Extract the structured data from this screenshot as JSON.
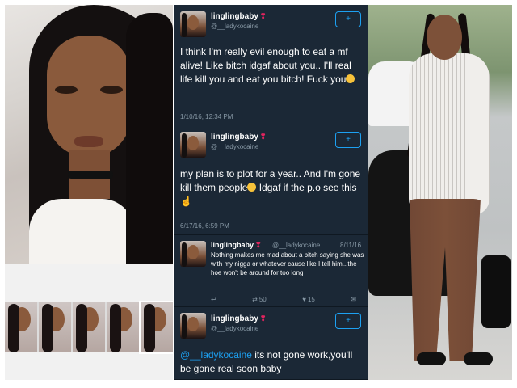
{
  "tweets": [
    {
      "name": "linglingbaby",
      "handle": "@__ladykocaine",
      "text_before": "I think I'm really evil enough to eat a mf alive! Like bitch idgaf about you.. I'll real life kill you and eat you bitch! Fuck you",
      "text_after": "",
      "timestamp": "1/10/16, 12:34 PM",
      "follow_label": "+"
    },
    {
      "name": "linglingbaby",
      "handle": "@__ladykocaine",
      "text_before": "my plan is to plot for a year.. And I'm gone kill them people",
      "text_after": " Idgaf if the p.o see this",
      "timestamp": "6/17/16, 6:59 PM",
      "follow_label": "+"
    },
    {
      "name": "linglingbaby",
      "handle": "@__ladykocaine",
      "date": "8/11/16",
      "text": "Nothing makes me mad about a bitch saying she was with my nigga or whatever cause like I tell him...the hoe won't be around for too long",
      "retweets": "50",
      "likes": "15",
      "reply_icon": "reply-icon",
      "retweet_icon": "retweet-icon",
      "like_icon": "heart-icon",
      "dm_icon": "message-icon"
    },
    {
      "name": "linglingbaby",
      "handle": "@__ladykocaine",
      "mention": "@__ladykocaine",
      "text": " its not gone work,you'll be gone real soon baby",
      "follow_label": "+"
    }
  ],
  "colors": {
    "panel_bg": "#1b2836",
    "accent": "#1da1f2",
    "muted": "#8899a6"
  },
  "icons": {
    "follow": "add-user-icon",
    "more": "more-dots-icon"
  }
}
